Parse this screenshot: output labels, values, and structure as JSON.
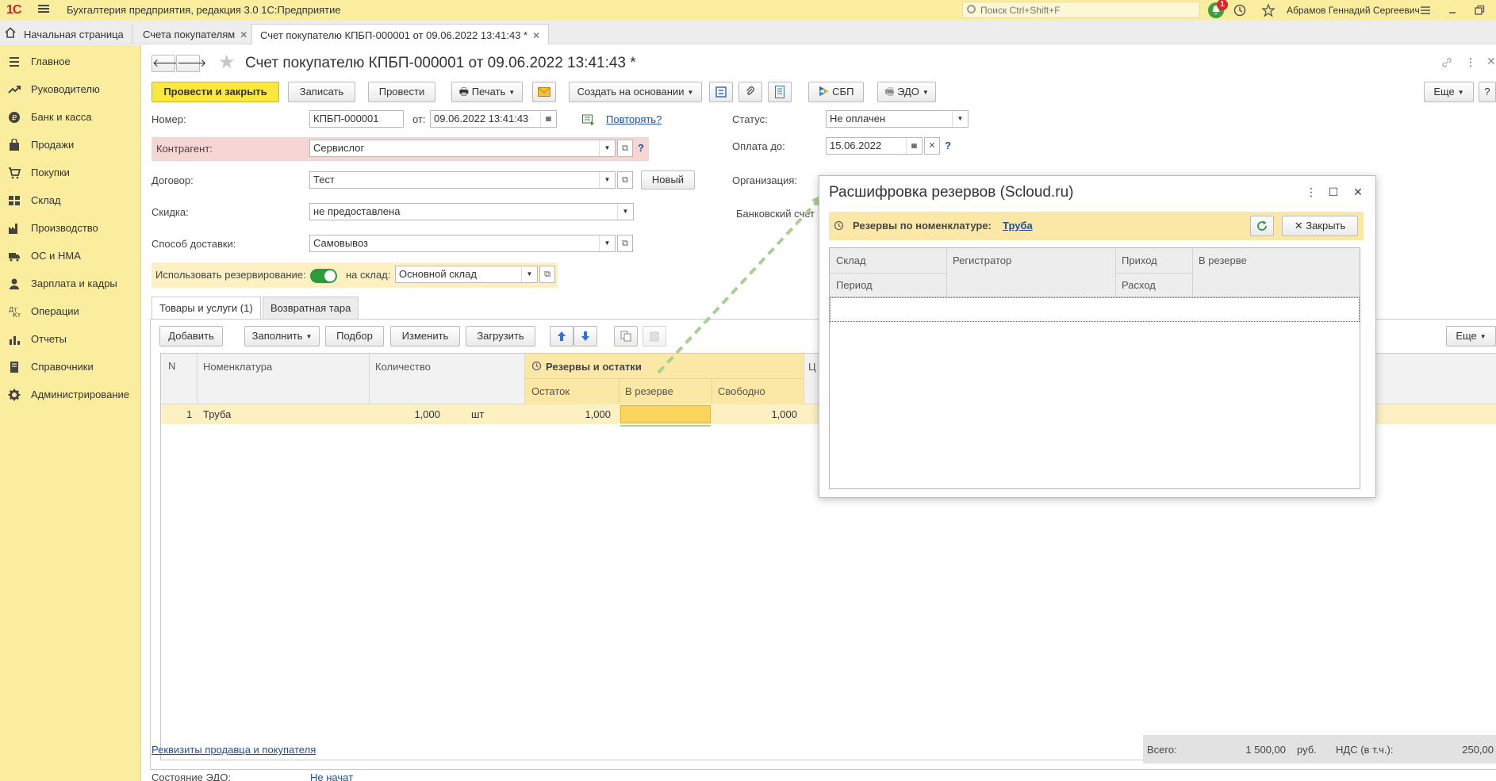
{
  "app": {
    "logo": "1С",
    "title": "Бухгалтерия предприятия, редакция 3.0 1С:Предприятие",
    "search_placeholder": "Поиск Ctrl+Shift+F",
    "notifications_count": "1",
    "user": "Абрамов Геннадий Сергеевич"
  },
  "tabs": [
    {
      "label": "Начальная страница"
    },
    {
      "label": "Счета покупателям",
      "close": "✕"
    },
    {
      "label": "Счет покупателю КПБП-000001 от 09.06.2022 13:41:43 *",
      "close": "✕"
    }
  ],
  "sidebar": {
    "items": [
      {
        "label": "Главное",
        "icon": "menu-icon"
      },
      {
        "label": "Руководителю",
        "icon": "trend-icon"
      },
      {
        "label": "Банк и касса",
        "icon": "coin-icon"
      },
      {
        "label": "Продажи",
        "icon": "bag-icon"
      },
      {
        "label": "Покупки",
        "icon": "cart-icon"
      },
      {
        "label": "Склад",
        "icon": "warehouse-icon"
      },
      {
        "label": "Производство",
        "icon": "factory-icon"
      },
      {
        "label": "ОС и НМА",
        "icon": "truck-icon"
      },
      {
        "label": "Зарплата и кадры",
        "icon": "person-icon"
      },
      {
        "label": "Операции",
        "icon": "operations-icon"
      },
      {
        "label": "Отчеты",
        "icon": "report-icon"
      },
      {
        "label": "Справочники",
        "icon": "book-icon"
      },
      {
        "label": "Администрирование",
        "icon": "gear-icon"
      }
    ]
  },
  "form": {
    "title": "Счет покупателю КПБП-000001 от 09.06.2022 13:41:43 *",
    "toolbar": {
      "post_close": "Провести и закрыть",
      "save": "Записать",
      "post": "Провести",
      "print": "Печать",
      "create_based": "Создать на основании",
      "sbp": "СБП",
      "edo": "ЭДО",
      "more": "Еще",
      "help": "?"
    },
    "number_label": "Номер:",
    "number": "КПБП-000001",
    "from_label": "от:",
    "date": "09.06.2022 13:41:43",
    "repeat_link": "Повторять?",
    "status_label": "Статус:",
    "status": "Не оплачен",
    "pay_until_label": "Оплата до:",
    "pay_until": "15.06.2022",
    "counterparty_label": "Контрагент:",
    "counterparty": "Сервислог",
    "contract_label": "Договор:",
    "contract": "Тест",
    "new_btn": "Новый",
    "org_label": "Организация:",
    "bank_label": "Банковский счет",
    "discount_label": "Скидка:",
    "discount": "не предоставлена",
    "delivery_label": "Способ доставки:",
    "delivery": "Самовывоз",
    "reserve_label": "Использовать резервирование:",
    "warehouse_label": "на склад:",
    "warehouse": "Основной склад",
    "table_tabs": [
      "Товары и услуги (1)",
      "Возвратная тара"
    ],
    "table_toolbar": {
      "add": "Добавить",
      "fill": "Заполнить",
      "pick": "Подбор",
      "change": "Изменить",
      "load": "Загрузить",
      "more": "Еще"
    },
    "table": {
      "headers": {
        "n": "N",
        "item": "Номенклатура",
        "qty": "Количество",
        "group": "Резервы и остатки",
        "rest": "Остаток",
        "reserved": "В резерве",
        "free": "Свободно",
        "price": "Ц"
      },
      "rows": [
        {
          "n": "1",
          "item": "Труба",
          "qty": "1,000",
          "unit": "шт",
          "rest": "1,000",
          "reserved": "",
          "free": "1,000"
        }
      ]
    },
    "footer": {
      "details_link": "Реквизиты продавца и покупателя",
      "edo_label": "Состояние ЭДО:",
      "edo_value": "Не начат",
      "total_label": "Всего:",
      "total": "1 500,00",
      "currency": "руб.",
      "vat_label": "НДС (в т.ч.):",
      "vat": "250,00"
    }
  },
  "dialog": {
    "title": "Расшифровка резервов (Scloud.ru)",
    "bar_label": "Резервы по номенклатуре:",
    "bar_link": "Труба",
    "close_btn": "Закрыть",
    "headers": {
      "warehouse": "Склад",
      "period": "Период",
      "registrar": "Регистратор",
      "income": "Приход",
      "expense": "Расход",
      "reserved": "В резерве"
    }
  },
  "colors": {
    "accent_yellow": "#fbed9e",
    "primary_button": "#fbe83f",
    "link": "#1f4fa3",
    "toggle_on": "#2e9b3a",
    "error_bg": "#f6d5d5",
    "arrow": "#a8cf95"
  }
}
